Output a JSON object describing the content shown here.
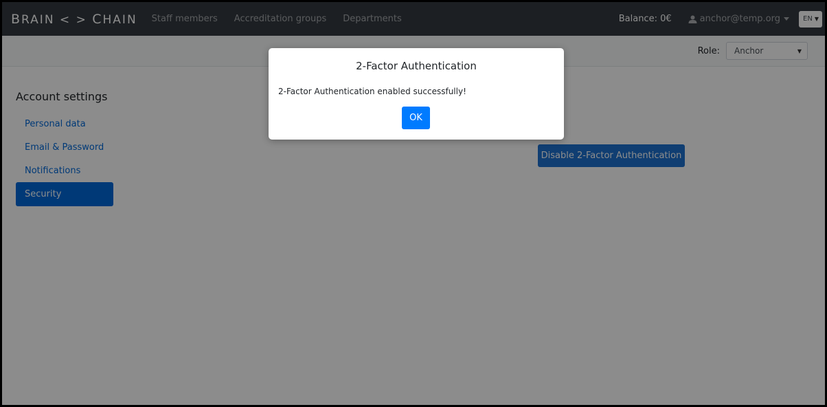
{
  "navbar": {
    "brand": {
      "b": "B",
      "rain": "RAIN",
      "sep": " < > ",
      "c": "C",
      "hain": "HAIN"
    },
    "links": [
      "Staff members",
      "Accreditation groups",
      "Departments"
    ],
    "balance": "Balance: 0€",
    "user_email": "anchor@temp.org",
    "language": "EN"
  },
  "subbar": {
    "role_label": "Role:",
    "role_value": "Anchor"
  },
  "sidebar": {
    "title": "Account settings",
    "items": [
      {
        "label": "Personal data",
        "active": false
      },
      {
        "label": "Email & Password",
        "active": false
      },
      {
        "label": "Notifications",
        "active": false
      },
      {
        "label": "Security",
        "active": true
      }
    ]
  },
  "main": {
    "disable_2fa_label": "Disable 2-Factor Authentication"
  },
  "modal": {
    "title": "2-Factor Authentication",
    "message": "2-Factor Authentication enabled successfully!",
    "ok_label": "OK"
  },
  "colors": {
    "navbar_bg": "#343a40",
    "primary": "#007bff",
    "active_item": "#0069d9"
  }
}
